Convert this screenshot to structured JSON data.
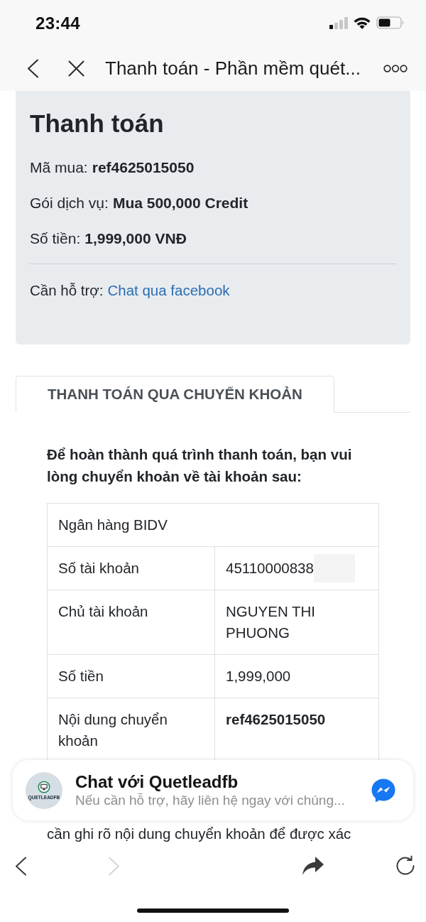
{
  "status_bar": {
    "time": "23:44"
  },
  "browser_bar": {
    "title": "Thanh toán - Phần mềm quét..."
  },
  "summary": {
    "heading": "Thanh toán",
    "fields": [
      {
        "label": "Mã mua:",
        "value": "ref4625015050"
      },
      {
        "label": "Gói dịch vụ:",
        "value": "Mua 500,000 Credit"
      },
      {
        "label": "Số tiền:",
        "value": "1,999,000 VNĐ"
      }
    ],
    "support": {
      "label": "Cần hỗ trợ:",
      "link": "Chat qua facebook"
    }
  },
  "tabs": [
    {
      "label": "THANH TOÁN QUA CHUYỂN KHOẢN",
      "selected": true
    }
  ],
  "instructions": "Để hoàn thành quá trình thanh toán, bạn vui lòng chuyển khoản về tài khoản sau:",
  "bank_table": {
    "rows": [
      {
        "kind": "full",
        "label": "Ngân hàng BIDV"
      },
      {
        "kind": "pair",
        "label": "Số tài khoản",
        "value": "45110000838",
        "redacted": true,
        "bold": false
      },
      {
        "kind": "pair",
        "label": "Chủ tài khoản",
        "value": "NGUYEN THI PHUONG",
        "redacted": false,
        "bold": false
      },
      {
        "kind": "pair",
        "label": "Số tiền",
        "value": "1,999,000",
        "redacted": false,
        "bold": false
      },
      {
        "kind": "pair",
        "label": "Nội dung chuyển khoản",
        "value": "ref4625015050",
        "redacted": false,
        "bold": true
      }
    ]
  },
  "note_line": "cần ghi rõ nội dung chuyển khoản để được xác",
  "chat_popup": {
    "avatar_text": "QUETLEADFB",
    "title": "Chat với Quetleadfb",
    "subtitle": "Nếu cần hỗ trợ, hãy liên hệ ngay với chúng..."
  },
  "toolbar": {
    "buttons": [
      {
        "kind": "back",
        "disabled": false
      },
      {
        "kind": "forward",
        "disabled": true
      },
      {
        "kind": "share",
        "disabled": false
      },
      {
        "kind": "reload",
        "disabled": false
      }
    ]
  }
}
